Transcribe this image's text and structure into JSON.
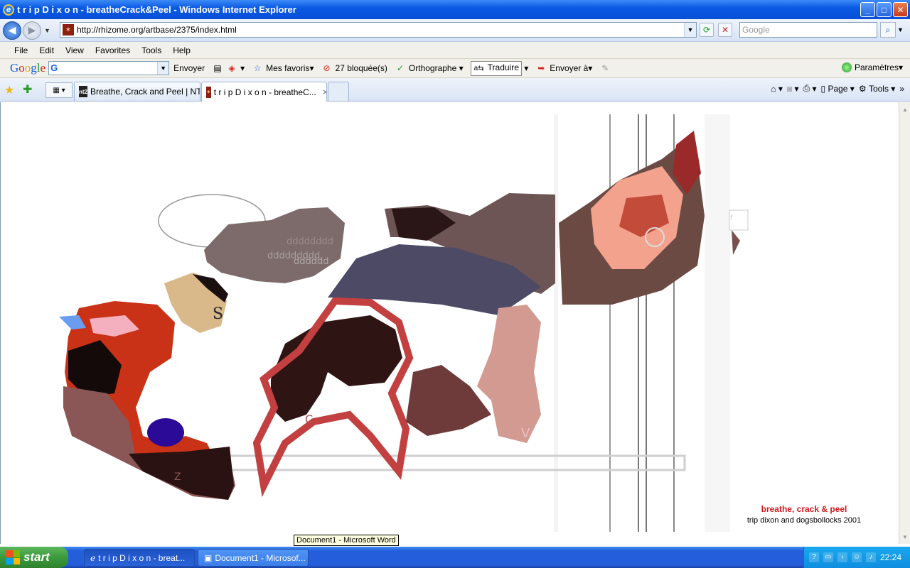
{
  "window": {
    "title": "t r i p D i x o n - breatheCrack&Peel - Windows Internet Explorer",
    "controls": {
      "minimize": "_",
      "maximize": "□",
      "close": "✕"
    }
  },
  "nav": {
    "address": "http://rhizome.org/artbase/2375/index.html",
    "search_placeholder": "Google"
  },
  "menu": [
    "File",
    "Edit",
    "View",
    "Favorites",
    "Tools",
    "Help"
  ],
  "google_toolbar": {
    "search_button": "Envoyer",
    "favorites": "Mes favoris",
    "blocked": "27 bloquée(s)",
    "spelling": "Orthographe",
    "translate": "Traduire",
    "send_to": "Envoyer à",
    "settings": "Paramètres"
  },
  "tabs": [
    {
      "label": "Breathe, Crack and Peel | NT2",
      "icon": "nt2"
    },
    {
      "label": "t r i p D i x o n - breatheC...",
      "icon": "artbase"
    }
  ],
  "right_tools": {
    "page": "Page",
    "tools": "Tools"
  },
  "artwork": {
    "title": "breathe, crack & peel",
    "credit": "trip dixon and dogsbollocks 2001",
    "glyph_s": "S",
    "glyph_c": "C",
    "glyph_v": "V",
    "glyph_z": "Z",
    "glyph_f": "f",
    "faded_text_1": "dddddddd",
    "faded_text_2": "ddddddddd",
    "faded_text_3": "dddddd"
  },
  "tooltip": "Document1 - Microsoft Word",
  "taskbar": {
    "start": "start",
    "tasks": [
      {
        "label": "t r i p D i x o n - breat..."
      },
      {
        "label": "Document1 - Microsof..."
      }
    ],
    "clock": "22:24"
  }
}
